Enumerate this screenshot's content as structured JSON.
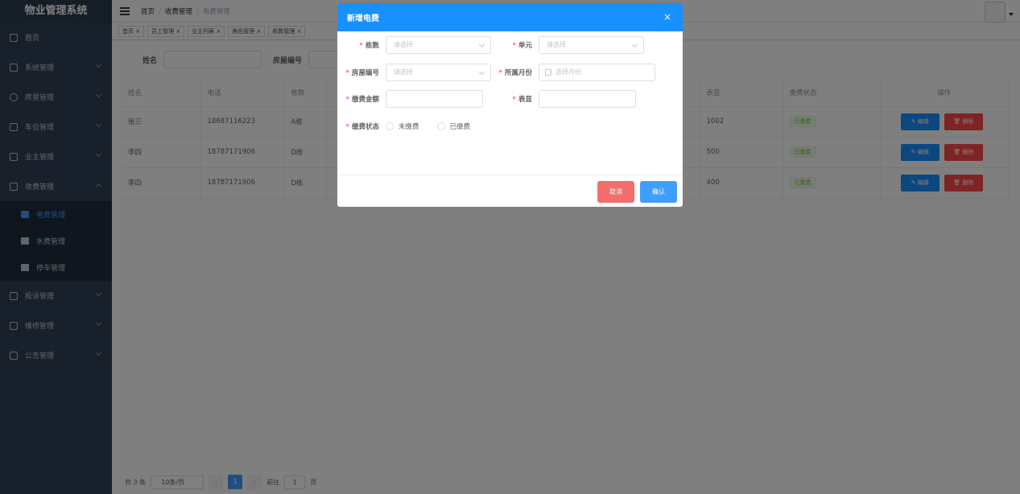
{
  "app": {
    "title": "物业管理系统"
  },
  "sidebar": {
    "items": [
      {
        "label": "首页",
        "icon": "dashboard-icon"
      },
      {
        "label": "系统管理",
        "icon": "system-icon"
      },
      {
        "label": "房屋管理",
        "icon": "house-icon"
      },
      {
        "label": "车位管理",
        "icon": "parking-icon"
      },
      {
        "label": "业主管理",
        "icon": "owner-icon"
      },
      {
        "label": "收费管理",
        "icon": "fee-icon"
      }
    ],
    "sub_items": [
      {
        "label": "电费管理",
        "icon": "electric-icon"
      },
      {
        "label": "水费管理",
        "icon": "water-icon"
      },
      {
        "label": "停车管理",
        "icon": "parking-fee-icon"
      }
    ],
    "items_after": [
      {
        "label": "投诉管理",
        "icon": "complaint-icon"
      },
      {
        "label": "维修管理",
        "icon": "repair-icon"
      },
      {
        "label": "公告管理",
        "icon": "notice-icon"
      }
    ]
  },
  "breadcrumb": {
    "home": "首页",
    "parent": "收费管理",
    "current": "电费管理",
    "sep": "/"
  },
  "tags": [
    "首页 ×",
    "员工管理 ×",
    "业主列表 ×",
    "角色管理 ×",
    "栋数管理 ×"
  ],
  "search": {
    "name_label": "姓名",
    "house_label": "房屋编号"
  },
  "table": {
    "headers": [
      "姓名",
      "电话",
      "栋数",
      "",
      "",
      "",
      "表显",
      "缴费状态",
      "操作"
    ],
    "rows": [
      {
        "name": "张三",
        "phone": "18687116223",
        "building": "A栋",
        "reading": "1002",
        "status": "已缴费"
      },
      {
        "name": "李四",
        "phone": "18787171906",
        "building": "D栋",
        "reading": "500",
        "status": "已缴费"
      },
      {
        "name": "李四",
        "phone": "18787171906",
        "building": "D栋",
        "reading": "400",
        "status": "已缴费"
      }
    ],
    "edit_label": "✎ 编辑",
    "delete_label": "🗑 删除"
  },
  "pagination": {
    "total": "共 3 条",
    "page_size": "10条/页",
    "current_page": "1",
    "goto_label": "前往",
    "goto_value": "1",
    "page_suffix": "页"
  },
  "dialog": {
    "title": "新增电费",
    "close": "×",
    "fields": {
      "building": {
        "label": "栋数",
        "placeholder": "请选择"
      },
      "unit": {
        "label": "单元",
        "placeholder": "请选择"
      },
      "house": {
        "label": "房屋编号",
        "placeholder": "请选择"
      },
      "month": {
        "label": "所属月份",
        "placeholder": "选择月份"
      },
      "amount": {
        "label": "缴费金额"
      },
      "reading": {
        "label": "表显"
      },
      "status": {
        "label": "缴费状态",
        "options": [
          "未缴费",
          "已缴费"
        ]
      }
    },
    "required_mark": "*",
    "cancel": "取消",
    "confirm": "确认"
  },
  "colors": {
    "primary": "#1890ff",
    "danger": "#f56c6c",
    "sidebar": "#304156",
    "success": "#67c23a"
  }
}
